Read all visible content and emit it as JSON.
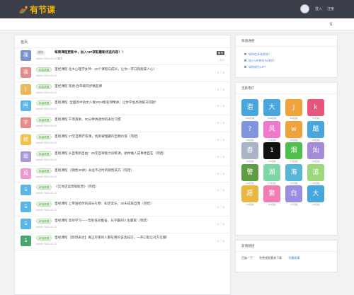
{
  "brand": {
    "name": "有节课"
  },
  "header": {
    "link1": "登入",
    "link2": "注册"
  },
  "feed": {
    "section_title": "首页",
    "pinned": {
      "avatar": "我",
      "avatar_color": "#7b8fd4",
      "tag": "精华",
      "title": "每周课程更新中，加入VIP获取最新优选内容！！",
      "meta": "admin  2022-03-12  置顶",
      "badge": "置顶",
      "stat": "◌ 112"
    },
    "items": [
      {
        "avatar": "我",
        "color": "#e98a8a",
        "tag": "科技资源",
        "title": "圣经课程 北大心理学女神：20个课程与成长，让你一开口就能安人心！",
        "meta": "admin  2022-03-12",
        "stat": "◌ 0  ♡ 0"
      },
      {
        "avatar": "J",
        "color": "#f0b65c",
        "tag": "科技资源",
        "title": "圣经课程 资源·各年级同步精品课",
        "meta": "admin  2022-03-12",
        "stat": "◌ 0  ♡ 0"
      },
      {
        "avatar": "阿",
        "color": "#5bb6e8",
        "tag": "科技资源",
        "title": "圣经课程 ·全国高中语文人教2024版名师精讲，让你学会高效解决问题！",
        "meta": "admin  2022-03-12",
        "stat": "◌ 0  ♡ 0"
      },
      {
        "avatar": "宇",
        "color": "#e98a8a",
        "tag": "科技资源",
        "title": "圣经课程 千场演讲，20分钟讲透你的表达习惯",
        "meta": "admin  2022-03-12",
        "stat": "◌ 0  ♡ 0"
      },
      {
        "avatar": "蛙",
        "color": "#f0c24e",
        "tag": "科技资源",
        "title": "圣经课程 17堂自我疗愈课，找到被埋藏的自我价值（完结）",
        "meta": "admin  2022-03-12",
        "stat": "◌ 0  ♡ 0"
      },
      {
        "avatar": "聪",
        "color": "#a99ad6",
        "tag": "科技资源",
        "title": "圣经课程 从自我到自由：25堂自律能力训练课，助你做人成事更自在（完结）",
        "meta": "admin  2022-03-12",
        "stat": "◌ 0  ♡ 0"
      },
      {
        "avatar": "风",
        "color": "#ee9ad2",
        "tag": "科技资源",
        "title": "圣经课程 《销售30讲》永远不过时的销售技巧（完结）",
        "meta": "admin  2022-03-12",
        "stat": "◌ 0  ♡ 0"
      },
      {
        "avatar": "S",
        "color": "#5bb6e8",
        "tag": "科技资源",
        "title": "《实体店运营赋能营》（完结）",
        "meta": "admin  2022-03-12",
        "stat": "◌ 0  ♡ 0"
      },
      {
        "avatar": "S",
        "color": "#5bb6e8",
        "tag": "科技资源",
        "title": "圣经课程 上帝送给你的成长礼物：知足常乐，30天成就自我（完结）",
        "meta": "admin  2022-03-12",
        "stat": "◌ 0  ♡ 0"
      },
      {
        "avatar": "S",
        "color": "#5bb6e8",
        "tag": "科技资源",
        "title": "圣经课程 高效学习——告别低效勤奋，从学霸到人生赢家（完结）",
        "meta": "admin  2022-03-12",
        "stat": "◌ 0  ♡ 0"
      },
      {
        "avatar": "S",
        "color": "#4aa56a",
        "tag": "科技资源",
        "title": "圣经课程 【职场表达】真正厉害的人都在用的说话技巧，一开口就让对方信服！",
        "meta": "admin  2022-03-12",
        "stat": "◌ 0  ♡ 0"
      }
    ]
  },
  "quick_links": {
    "title": "快速通道",
    "items": [
      "如何在本站发帖？",
      "加入VIP有什么好处？",
      "如何成为VIP？"
    ]
  },
  "active_users": {
    "title": "活跃用户",
    "tiles": [
      {
        "char": "谐",
        "color": "#49a6dd",
        "sub": "4060回帖"
      },
      {
        "char": "大",
        "color": "#49a6dd",
        "sub": "1028回帖"
      },
      {
        "char": "J",
        "color": "#f0a23c",
        "sub": "954回帖"
      },
      {
        "char": "k",
        "color": "#e5567a",
        "sub": "752回帖"
      },
      {
        "char": "?",
        "color": "#7f95e0",
        "sub": "688回帖"
      },
      {
        "char": "风",
        "color": "#ee78c9",
        "sub": "523回帖"
      },
      {
        "char": "w",
        "color": "#f0a23c",
        "sub": "433回帖"
      },
      {
        "char": "酷",
        "color": "#49a6dd",
        "sub": "408回帖"
      },
      {
        "char": "春",
        "color": "#aab4c6",
        "sub": "389回帖"
      },
      {
        "char": "1",
        "color": "#111111",
        "sub": "311回帖"
      },
      {
        "char": "烟",
        "color": "#4fc04c",
        "sub": "276回帖"
      },
      {
        "char": "灿",
        "color": "#a58bd8",
        "sub": "259回帖"
      },
      {
        "char": "警",
        "color": "#5d9d45",
        "sub": "233回帖"
      },
      {
        "char": "湖",
        "color": "#7ed6a6",
        "sub": "218回帖"
      },
      {
        "char": "海",
        "color": "#58b7d6",
        "sub": "197回帖"
      },
      {
        "char": "追",
        "color": "#9ed77e",
        "sub": "181回帖"
      },
      {
        "char": "愿",
        "color": "#e8b842",
        "sub": "165回帖"
      },
      {
        "char": "繁",
        "color": "#f27db3",
        "sub": "153回帖"
      },
      {
        "char": "白",
        "color": "#9a8ee0",
        "sub": "147回帖"
      },
      {
        "char": "大",
        "color": "#49a6dd",
        "sub": "139回帖"
      }
    ]
  },
  "friend_links": {
    "title": "友情链接",
    "items": [
      "百度一下",
      "免费视频素材下载",
      "早晨故事"
    ]
  }
}
